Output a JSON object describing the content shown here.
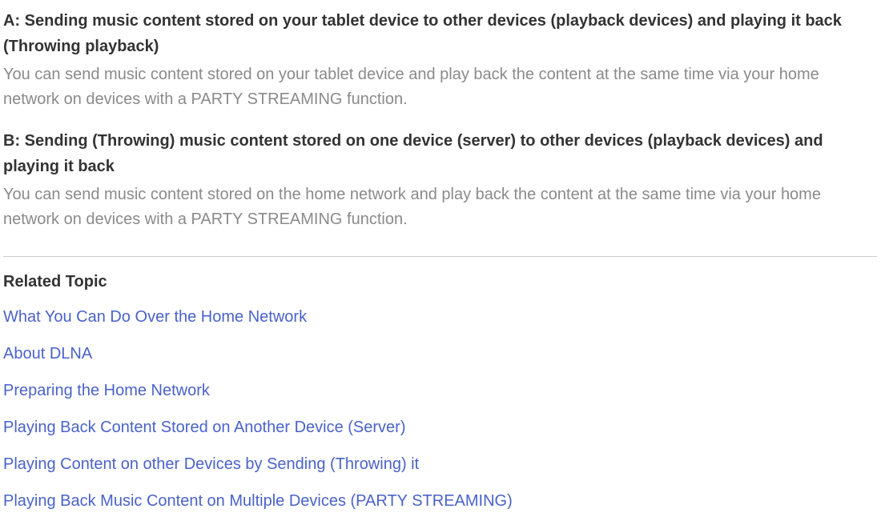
{
  "section_a": {
    "heading": "A: Sending music content stored on your tablet device to other devices (playback devices) and playing it back (Throwing playback)",
    "body": "You can send music content stored on your tablet device and play back the content at the same time via your home network on devices with a PARTY STREAMING function."
  },
  "section_b": {
    "heading": "B: Sending (Throwing) music content stored on one device (server) to other devices (playback devices) and playing it back",
    "body": "You can send music content stored on the home network and play back the content at the same time via your home network on devices with a PARTY STREAMING function."
  },
  "related": {
    "title": "Related Topic",
    "links": [
      "What You Can Do Over the Home Network",
      "About DLNA",
      "Preparing the Home Network",
      "Playing Back Content Stored on Another Device (Server)",
      "Playing Content on other Devices by Sending (Throwing) it",
      "Playing Back Music Content on Multiple Devices (PARTY STREAMING)"
    ]
  }
}
